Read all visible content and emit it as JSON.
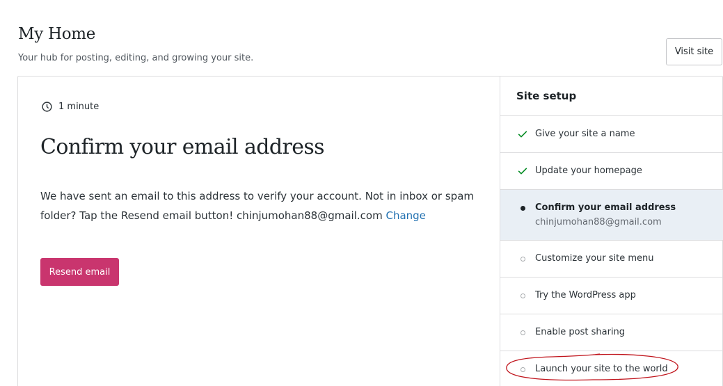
{
  "header": {
    "title": "My Home",
    "subtitle": "Your hub for posting, editing, and growing your site.",
    "visit_site_label": "Visit site"
  },
  "task": {
    "time_icon": "clock-icon",
    "time_estimate": "1 minute",
    "title": "Confirm your email address",
    "description": "We have sent an email to this address to verify your account. Not in inbox or spam folder? Tap the Resend email button! chinjumohan88@gmail.com",
    "change_link": "Change",
    "resend_button": "Resend email",
    "button_color": "#c9356e",
    "link_color": "#2271b1"
  },
  "site_setup": {
    "heading": "Site setup",
    "items": [
      {
        "label": "Give your site a name",
        "status": "completed",
        "icon": "check-icon"
      },
      {
        "label": "Update your homepage",
        "status": "completed",
        "icon": "check-icon"
      },
      {
        "label": "Confirm your email address",
        "sublabel": "chinjumohan88@gmail.com",
        "status": "active",
        "icon": "dot-icon"
      },
      {
        "label": "Customize your site menu",
        "status": "pending",
        "icon": "circle-icon"
      },
      {
        "label": "Try the WordPress app",
        "status": "pending",
        "icon": "circle-icon"
      },
      {
        "label": "Enable post sharing",
        "status": "pending",
        "icon": "circle-icon"
      },
      {
        "label": "Launch your site to the world",
        "status": "pending",
        "icon": "circle-icon"
      }
    ],
    "check_color": "#008a20",
    "active_bg": "#e9eff5"
  },
  "annotation": {
    "color": "#c0141c"
  }
}
